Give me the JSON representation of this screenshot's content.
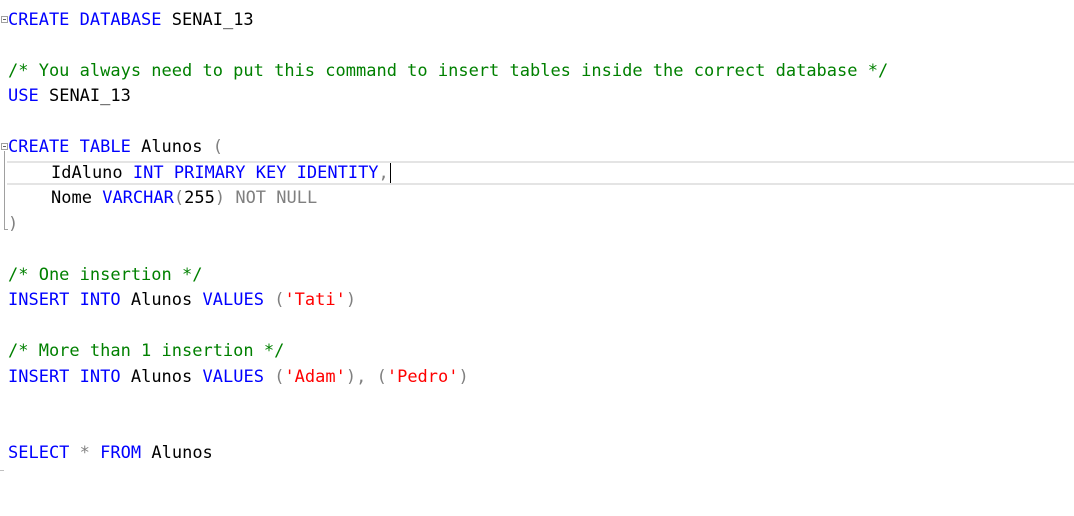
{
  "editor": {
    "line1": {
      "kw1": "CREATE DATABASE",
      "name": "SENAI_13"
    },
    "line3": {
      "comment": "/* You always need to put this command to insert tables inside the correct database */"
    },
    "line4": {
      "kw": "USE",
      "name": "SENAI_13"
    },
    "line6": {
      "kw": "CREATE TABLE",
      "name": "Alunos",
      "paren": "("
    },
    "line7": {
      "col": "IdAluno",
      "kw": "INT PRIMARY KEY IDENTITY",
      "comma": ","
    },
    "line8": {
      "col": "Nome",
      "kw": "VARCHAR",
      "open": "(",
      "num": "255",
      "close": ")",
      "nn": "NOT NULL"
    },
    "line9": {
      "paren": ")"
    },
    "line11": {
      "comment": "/* One insertion */"
    },
    "line12": {
      "kw1": "INSERT INTO",
      "table": "Alunos",
      "kw2": "VALUES",
      "open": "(",
      "s1": "'Tati'",
      "close": ")"
    },
    "line14": {
      "comment": "/* More than 1 insertion */"
    },
    "line15": {
      "kw1": "INSERT INTO",
      "table": "Alunos",
      "kw2": "VALUES",
      "open1": "(",
      "s1": "'Adam'",
      "close1": "),",
      "open2": "(",
      "s2": "'Pedro'",
      "close2": ")"
    },
    "line18": {
      "kw1": "SELECT",
      "star": "*",
      "kw2": "FROM",
      "table": "Alunos"
    }
  },
  "colors": {
    "keyword": "#0000ff",
    "comment": "#008000",
    "string": "#ff0000",
    "operator": "#808080"
  }
}
